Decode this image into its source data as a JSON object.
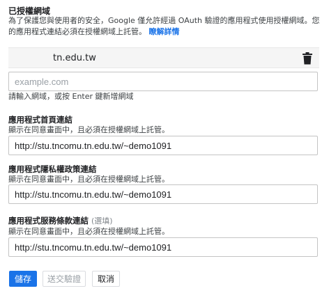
{
  "authorized_domains": {
    "title": "已授權網域",
    "description": "為了保護您與使用者的安全，Google 僅允許經過 OAuth 驗證的應用程式使用授權網域。您的應用程式連結必須在授權網域上託管。",
    "learn_more": "瞭解詳情",
    "domains": [
      "tn.edu.tw"
    ],
    "delete_icon": "trash-icon",
    "new_domain_placeholder": "example.com",
    "new_domain_hint": "請輸入網域，或按 Enter 鍵新增網域"
  },
  "fields": {
    "homepage": {
      "label": "應用程式首頁連結",
      "hint": "顯示在同意畫面中，且必須在授權網域上託管。",
      "value": "http://stu.tncomu.tn.edu.tw/~demo1091"
    },
    "privacy": {
      "label": "應用程式隱私權政策連結",
      "hint": "顯示在同意畫面中，且必須在授權網域上託管。",
      "value": "http://stu.tncomu.tn.edu.tw/~demo1091"
    },
    "terms": {
      "label": "應用程式服務條款連結",
      "optional": "(選填)",
      "hint": "顯示在同意畫面中，且必須在授權網域上託管。",
      "value": "http://stu.tncomu.tn.edu.tw/~demo1091"
    }
  },
  "actions": {
    "save": "儲存",
    "submit_verification": "送交驗證",
    "cancel": "取消"
  },
  "colors": {
    "accent": "#1a73e8",
    "disabled_text": "#9aa0a6"
  }
}
